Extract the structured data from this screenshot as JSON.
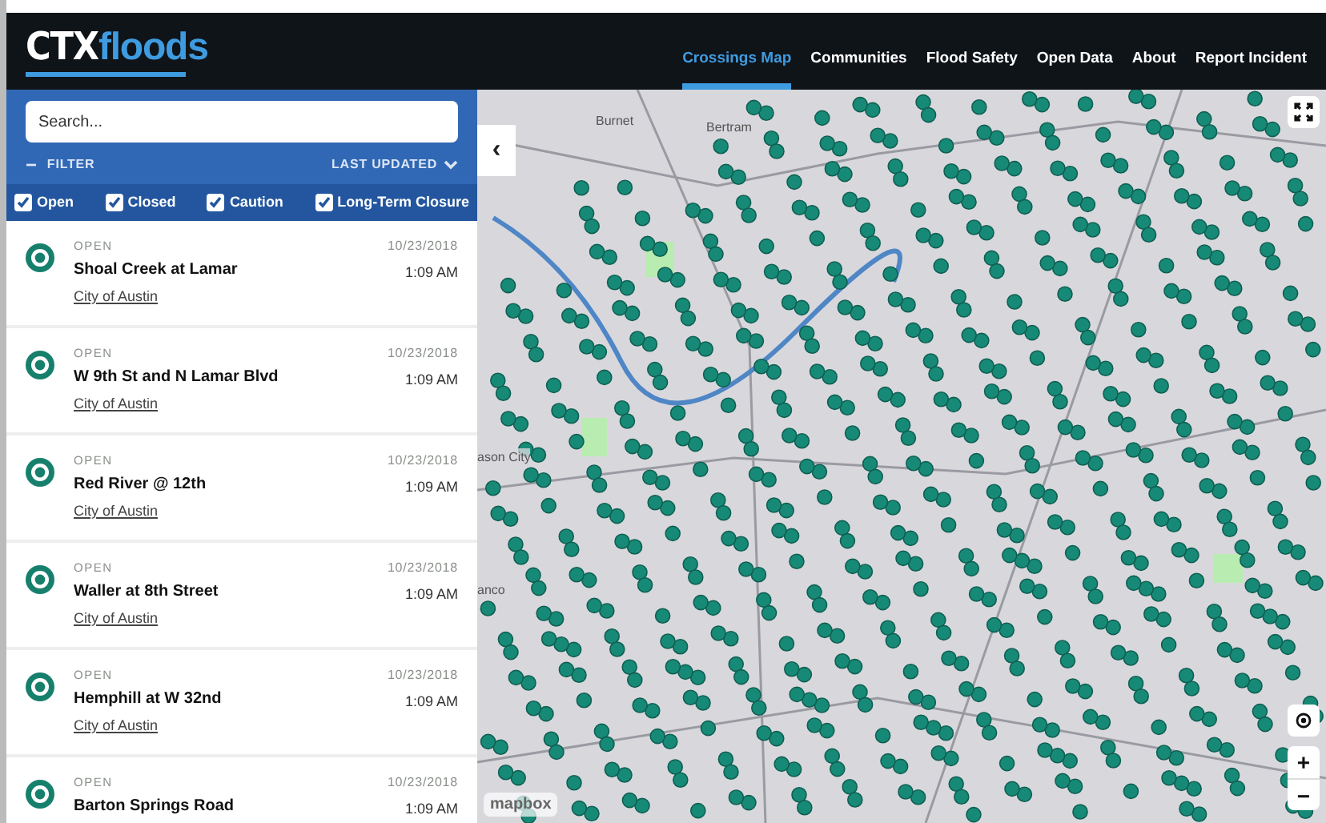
{
  "header": {
    "logo": {
      "prefix": "CTX",
      "suffix": "floods"
    },
    "nav": [
      {
        "label": "Crossings Map",
        "selected": true
      },
      {
        "label": "Communities",
        "selected": false
      },
      {
        "label": "Flood Safety",
        "selected": false
      },
      {
        "label": "Open Data",
        "selected": false
      },
      {
        "label": "About",
        "selected": false
      },
      {
        "label": "Report Incident",
        "selected": false
      }
    ]
  },
  "sidebar": {
    "search": {
      "placeholder": "Search..."
    },
    "filter_toggle": {
      "icon": "−",
      "label": "FILTER"
    },
    "sort": {
      "label": "LAST UPDATED"
    },
    "filters": [
      {
        "label": "Open",
        "checked": true
      },
      {
        "label": "Closed",
        "checked": true
      },
      {
        "label": "Caution",
        "checked": true
      },
      {
        "label": "Long-Term Closure",
        "checked": true
      }
    ],
    "crossings": [
      {
        "status": "OPEN",
        "name": "Shoal Creek at Lamar",
        "community": "City of Austin",
        "date": "10/23/2018",
        "time": "1:09 AM"
      },
      {
        "status": "OPEN",
        "name": "W 9th St and N Lamar Blvd",
        "community": "City of Austin",
        "date": "10/23/2018",
        "time": "1:09 AM"
      },
      {
        "status": "OPEN",
        "name": "Red River @ 12th",
        "community": "City of Austin",
        "date": "10/23/2018",
        "time": "1:09 AM"
      },
      {
        "status": "OPEN",
        "name": "Waller at 8th Street",
        "community": "City of Austin",
        "date": "10/23/2018",
        "time": "1:09 AM"
      },
      {
        "status": "OPEN",
        "name": "Hemphill at W 32nd",
        "community": "City of Austin",
        "date": "10/23/2018",
        "time": "1:09 AM"
      },
      {
        "status": "OPEN",
        "name": "Barton Springs Road",
        "date": "10/23/2018",
        "time": "1:09 AM"
      }
    ]
  },
  "map": {
    "collapse_button": "‹",
    "labels": [
      "Burnet",
      "Bertram",
      "ason City",
      "anco"
    ],
    "attribution": "mapbox",
    "zoom_in": "+",
    "zoom_out": "−"
  }
}
